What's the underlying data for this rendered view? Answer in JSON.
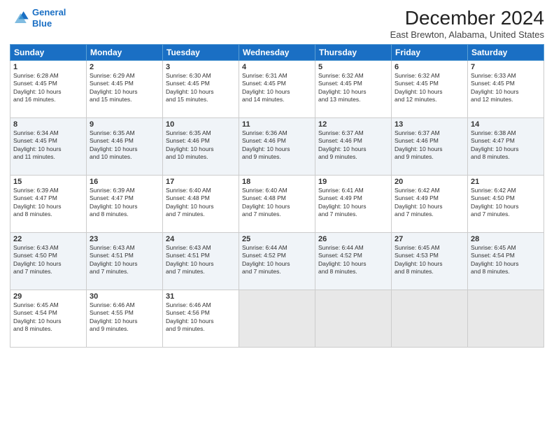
{
  "header": {
    "logo_line1": "General",
    "logo_line2": "Blue",
    "title": "December 2024",
    "subtitle": "East Brewton, Alabama, United States"
  },
  "days_of_week": [
    "Sunday",
    "Monday",
    "Tuesday",
    "Wednesday",
    "Thursday",
    "Friday",
    "Saturday"
  ],
  "weeks": [
    [
      {
        "day": 1,
        "lines": [
          "Sunrise: 6:28 AM",
          "Sunset: 4:45 PM",
          "Daylight: 10 hours",
          "and 16 minutes."
        ]
      },
      {
        "day": 2,
        "lines": [
          "Sunrise: 6:29 AM",
          "Sunset: 4:45 PM",
          "Daylight: 10 hours",
          "and 15 minutes."
        ]
      },
      {
        "day": 3,
        "lines": [
          "Sunrise: 6:30 AM",
          "Sunset: 4:45 PM",
          "Daylight: 10 hours",
          "and 15 minutes."
        ]
      },
      {
        "day": 4,
        "lines": [
          "Sunrise: 6:31 AM",
          "Sunset: 4:45 PM",
          "Daylight: 10 hours",
          "and 14 minutes."
        ]
      },
      {
        "day": 5,
        "lines": [
          "Sunrise: 6:32 AM",
          "Sunset: 4:45 PM",
          "Daylight: 10 hours",
          "and 13 minutes."
        ]
      },
      {
        "day": 6,
        "lines": [
          "Sunrise: 6:32 AM",
          "Sunset: 4:45 PM",
          "Daylight: 10 hours",
          "and 12 minutes."
        ]
      },
      {
        "day": 7,
        "lines": [
          "Sunrise: 6:33 AM",
          "Sunset: 4:45 PM",
          "Daylight: 10 hours",
          "and 12 minutes."
        ]
      }
    ],
    [
      {
        "day": 8,
        "lines": [
          "Sunrise: 6:34 AM",
          "Sunset: 4:45 PM",
          "Daylight: 10 hours",
          "and 11 minutes."
        ]
      },
      {
        "day": 9,
        "lines": [
          "Sunrise: 6:35 AM",
          "Sunset: 4:46 PM",
          "Daylight: 10 hours",
          "and 10 minutes."
        ]
      },
      {
        "day": 10,
        "lines": [
          "Sunrise: 6:35 AM",
          "Sunset: 4:46 PM",
          "Daylight: 10 hours",
          "and 10 minutes."
        ]
      },
      {
        "day": 11,
        "lines": [
          "Sunrise: 6:36 AM",
          "Sunset: 4:46 PM",
          "Daylight: 10 hours",
          "and 9 minutes."
        ]
      },
      {
        "day": 12,
        "lines": [
          "Sunrise: 6:37 AM",
          "Sunset: 4:46 PM",
          "Daylight: 10 hours",
          "and 9 minutes."
        ]
      },
      {
        "day": 13,
        "lines": [
          "Sunrise: 6:37 AM",
          "Sunset: 4:46 PM",
          "Daylight: 10 hours",
          "and 9 minutes."
        ]
      },
      {
        "day": 14,
        "lines": [
          "Sunrise: 6:38 AM",
          "Sunset: 4:47 PM",
          "Daylight: 10 hours",
          "and 8 minutes."
        ]
      }
    ],
    [
      {
        "day": 15,
        "lines": [
          "Sunrise: 6:39 AM",
          "Sunset: 4:47 PM",
          "Daylight: 10 hours",
          "and 8 minutes."
        ]
      },
      {
        "day": 16,
        "lines": [
          "Sunrise: 6:39 AM",
          "Sunset: 4:47 PM",
          "Daylight: 10 hours",
          "and 8 minutes."
        ]
      },
      {
        "day": 17,
        "lines": [
          "Sunrise: 6:40 AM",
          "Sunset: 4:48 PM",
          "Daylight: 10 hours",
          "and 7 minutes."
        ]
      },
      {
        "day": 18,
        "lines": [
          "Sunrise: 6:40 AM",
          "Sunset: 4:48 PM",
          "Daylight: 10 hours",
          "and 7 minutes."
        ]
      },
      {
        "day": 19,
        "lines": [
          "Sunrise: 6:41 AM",
          "Sunset: 4:49 PM",
          "Daylight: 10 hours",
          "and 7 minutes."
        ]
      },
      {
        "day": 20,
        "lines": [
          "Sunrise: 6:42 AM",
          "Sunset: 4:49 PM",
          "Daylight: 10 hours",
          "and 7 minutes."
        ]
      },
      {
        "day": 21,
        "lines": [
          "Sunrise: 6:42 AM",
          "Sunset: 4:50 PM",
          "Daylight: 10 hours",
          "and 7 minutes."
        ]
      }
    ],
    [
      {
        "day": 22,
        "lines": [
          "Sunrise: 6:43 AM",
          "Sunset: 4:50 PM",
          "Daylight: 10 hours",
          "and 7 minutes."
        ]
      },
      {
        "day": 23,
        "lines": [
          "Sunrise: 6:43 AM",
          "Sunset: 4:51 PM",
          "Daylight: 10 hours",
          "and 7 minutes."
        ]
      },
      {
        "day": 24,
        "lines": [
          "Sunrise: 6:43 AM",
          "Sunset: 4:51 PM",
          "Daylight: 10 hours",
          "and 7 minutes."
        ]
      },
      {
        "day": 25,
        "lines": [
          "Sunrise: 6:44 AM",
          "Sunset: 4:52 PM",
          "Daylight: 10 hours",
          "and 7 minutes."
        ]
      },
      {
        "day": 26,
        "lines": [
          "Sunrise: 6:44 AM",
          "Sunset: 4:52 PM",
          "Daylight: 10 hours",
          "and 8 minutes."
        ]
      },
      {
        "day": 27,
        "lines": [
          "Sunrise: 6:45 AM",
          "Sunset: 4:53 PM",
          "Daylight: 10 hours",
          "and 8 minutes."
        ]
      },
      {
        "day": 28,
        "lines": [
          "Sunrise: 6:45 AM",
          "Sunset: 4:54 PM",
          "Daylight: 10 hours",
          "and 8 minutes."
        ]
      }
    ],
    [
      {
        "day": 29,
        "lines": [
          "Sunrise: 6:45 AM",
          "Sunset: 4:54 PM",
          "Daylight: 10 hours",
          "and 8 minutes."
        ]
      },
      {
        "day": 30,
        "lines": [
          "Sunrise: 6:46 AM",
          "Sunset: 4:55 PM",
          "Daylight: 10 hours",
          "and 9 minutes."
        ]
      },
      {
        "day": 31,
        "lines": [
          "Sunrise: 6:46 AM",
          "Sunset: 4:56 PM",
          "Daylight: 10 hours",
          "and 9 minutes."
        ]
      },
      null,
      null,
      null,
      null
    ]
  ]
}
